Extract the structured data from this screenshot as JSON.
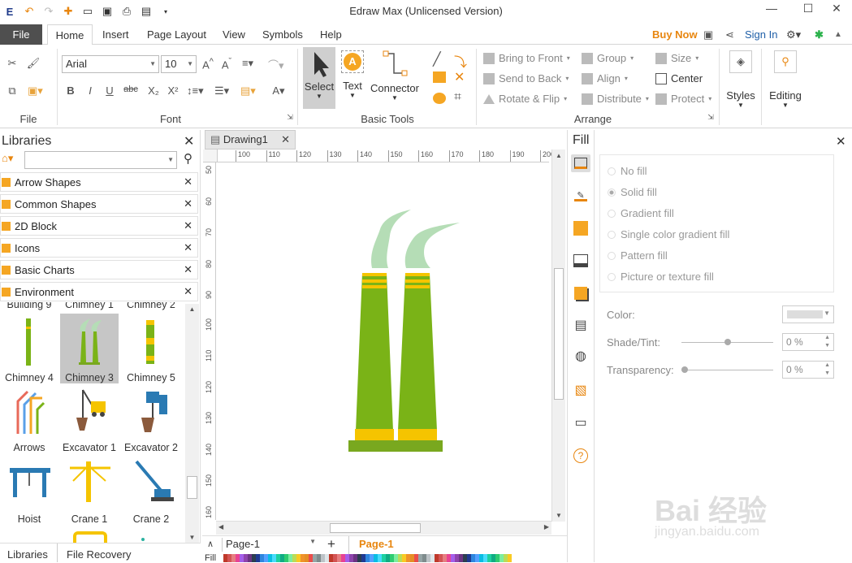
{
  "window": {
    "title": "Edraw Max (Unlicensed Version)"
  },
  "menu": {
    "file": "File",
    "tabs": [
      "Home",
      "Insert",
      "Page Layout",
      "View",
      "Symbols",
      "Help"
    ],
    "buy_now": "Buy Now",
    "sign_in": "Sign In"
  },
  "ribbon": {
    "font_name": "Arial",
    "font_size": "10",
    "groups": {
      "file": "File",
      "font": "Font",
      "basic_tools": "Basic Tools",
      "arrange": "Arrange"
    },
    "select": "Select",
    "text": "Text",
    "connector": "Connector",
    "arrange_items": {
      "bring_to_front": "Bring to Front",
      "send_to_back": "Send to Back",
      "rotate_flip": "Rotate & Flip",
      "group": "Group",
      "align": "Align",
      "distribute": "Distribute",
      "size": "Size",
      "center": "Center",
      "protect": "Protect"
    },
    "styles": "Styles",
    "editing": "Editing"
  },
  "libraries": {
    "title": "Libraries",
    "search_value": "",
    "categories": [
      "Arrow Shapes",
      "Common Shapes",
      "2D Block",
      "Icons",
      "Basic Charts",
      "Environment"
    ],
    "partial_labels": [
      "Building 9",
      "Chimney 1",
      "Chimney 2"
    ],
    "shapes": [
      {
        "label": "Chimney 4"
      },
      {
        "label": "Chimney 3"
      },
      {
        "label": "Chimney 5"
      },
      {
        "label": "Arrows"
      },
      {
        "label": "Excavator 1"
      },
      {
        "label": "Excavator 2"
      },
      {
        "label": "Hoist"
      },
      {
        "label": "Crane 1"
      },
      {
        "label": "Crane 2"
      }
    ],
    "bottom_tabs": [
      "Libraries",
      "File Recovery"
    ]
  },
  "document": {
    "tab": "Drawing1",
    "ruler_h": [
      "100",
      "110",
      "120",
      "130",
      "140",
      "150",
      "160",
      "170",
      "180",
      "190",
      "200"
    ],
    "ruler_v": [
      "50",
      "60",
      "70",
      "80",
      "90",
      "100",
      "110",
      "120",
      "130",
      "140",
      "150",
      "160"
    ],
    "page_selector": "Page-1",
    "active_page": "Page-1",
    "fill_label": "Fill"
  },
  "fill_panel": {
    "title": "Fill",
    "options": [
      "No fill",
      "Solid fill",
      "Gradient fill",
      "Single color gradient fill",
      "Pattern fill",
      "Picture or texture fill"
    ],
    "selected": "Solid fill",
    "color_label": "Color:",
    "shade_label": "Shade/Tint:",
    "shade_value": "0 %",
    "transparency_label": "Transparency:",
    "transparency_value": "0 %"
  },
  "colors": {
    "accent": "#e8860f",
    "chimney_green": "#7ab317",
    "chimney_yellow": "#f5c400",
    "smoke": "#b5ddb6",
    "base": "#79a81f"
  },
  "watermark": {
    "text": "Bai 经验",
    "url": "jingyan.baidu.com"
  }
}
